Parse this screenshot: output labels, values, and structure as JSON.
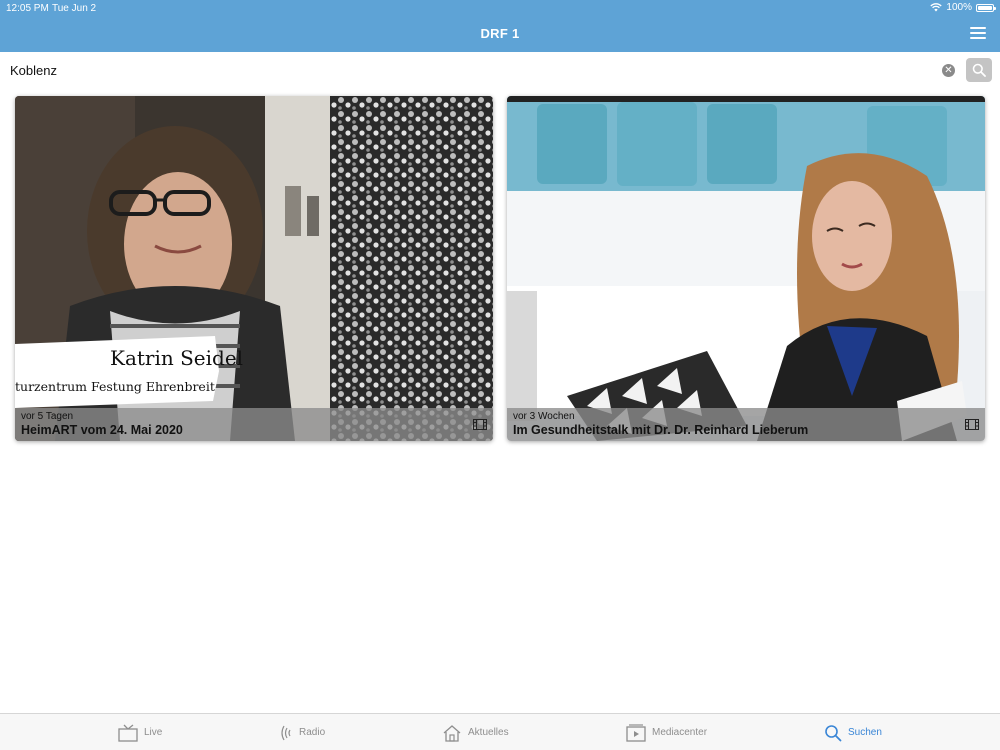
{
  "status": {
    "time": "12:05 PM",
    "date": "Tue Jun 2",
    "battery": "100%"
  },
  "header": {
    "title": "DRF 1"
  },
  "search": {
    "value": "Koblenz"
  },
  "results": [
    {
      "date": "vor 5 Tagen",
      "title": "HeimART vom 24. Mai 2020",
      "caption_name": "Katrin Seidel",
      "caption_sub": "turzentrum Festung Ehrenbreitstein"
    },
    {
      "date": "vor 3 Wochen",
      "title": "Im Gesundheitstalk mit Dr. Dr. Reinhard Lieberum"
    }
  ],
  "tabs": [
    {
      "label": "Live",
      "icon": "tv-icon"
    },
    {
      "label": "Radio",
      "icon": "radio-waves-icon"
    },
    {
      "label": "Aktuelles",
      "icon": "home-icon"
    },
    {
      "label": "Mediacenter",
      "icon": "play-box-icon"
    },
    {
      "label": "Suchen",
      "icon": "search-icon",
      "active": true
    }
  ],
  "colors": {
    "header": "#5ea3d6",
    "accent": "#3a86d6",
    "tab_inactive": "#8e8e8e"
  }
}
